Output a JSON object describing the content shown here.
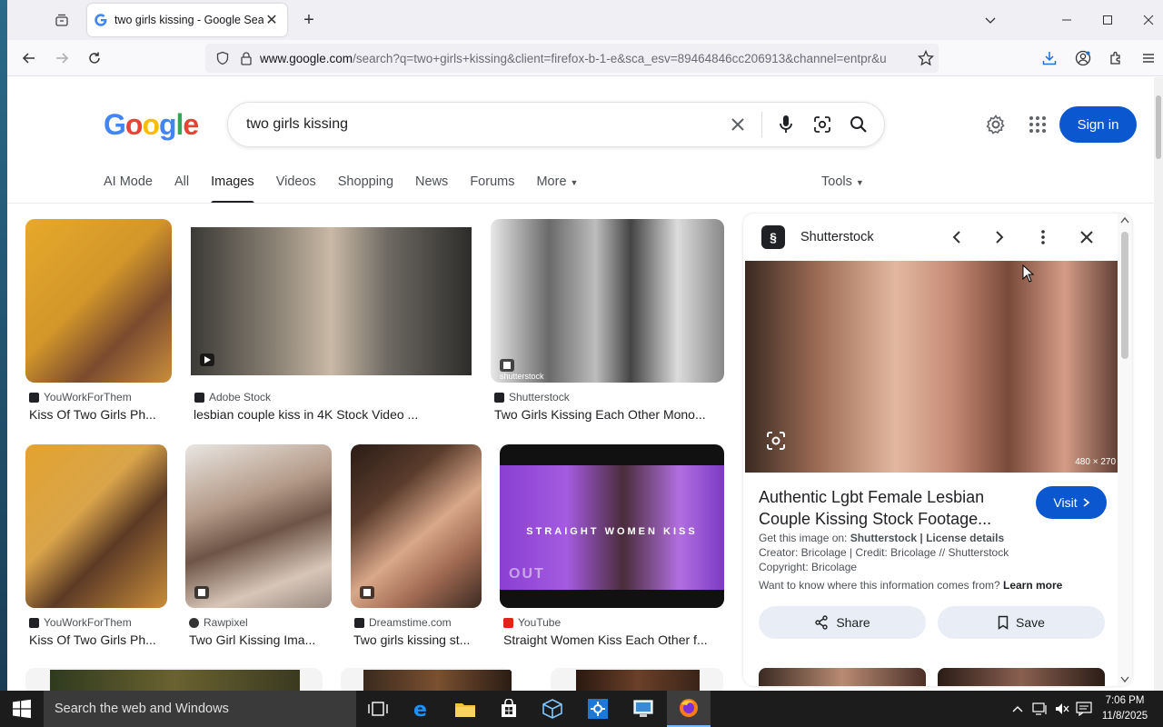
{
  "browser": {
    "tab_title": "two girls kissing - Google Search",
    "url_domain": "www.google.com",
    "url_path": "/search?q=two+girls+kissing&client=firefox-b-1-e&sca_esv=89464846cc206913&channel=entpr&u"
  },
  "google": {
    "query": "two girls kissing",
    "sign_in": "Sign in",
    "tabs": [
      "AI Mode",
      "All",
      "Images",
      "Videos",
      "Shopping",
      "News",
      "Forums",
      "More"
    ],
    "active_tab": "Images",
    "tools": "Tools"
  },
  "results": [
    {
      "source": "YouWorkForThem",
      "caption": "Kiss Of Two Girls Ph..."
    },
    {
      "source": "Adobe Stock",
      "caption": "lesbian couple kiss in 4K Stock Video ..."
    },
    {
      "source": "Shutterstock",
      "caption": "Two Girls Kissing Each Other Mono..."
    },
    {
      "source": "YouWorkForThem",
      "caption": "Kiss Of Two Girls Ph..."
    },
    {
      "source": "Rawpixel",
      "caption": "Two Girl Kissing Ima..."
    },
    {
      "source": "Dreamstime.com",
      "caption": "Two girls kissing st..."
    },
    {
      "source": "YouTube",
      "caption": "Straight Women Kiss Each Other f..."
    }
  ],
  "thumb_overlay_text": {
    "shutterstock_watermark": "shutterstock",
    "youtube_overlay": "STRAIGHT WOMEN KISS",
    "youtube_overlay2": "OUT"
  },
  "panel": {
    "site": "Shutterstock",
    "dimensions": "480 × 270",
    "title": "Authentic Lgbt Female Lesbian Couple Kissing Stock Footage...",
    "visit": "Visit",
    "get_image_prefix": "Get this image on: ",
    "get_image_site": "Shutterstock | License details",
    "creator": "Creator: Bricolage | Credit: Bricolage // Shutterstock",
    "copyright": "Copyright: Bricolage",
    "info_question": "Want to know where this information comes from? ",
    "learn_more": "Learn more",
    "share": "Share",
    "save": "Save"
  },
  "taskbar": {
    "search_placeholder": "Search the web and Windows",
    "time": "7:06 PM",
    "date": "11/8/2025"
  },
  "colors": {
    "accent": "#0b57d0",
    "button_bg": "#e9eef6"
  }
}
